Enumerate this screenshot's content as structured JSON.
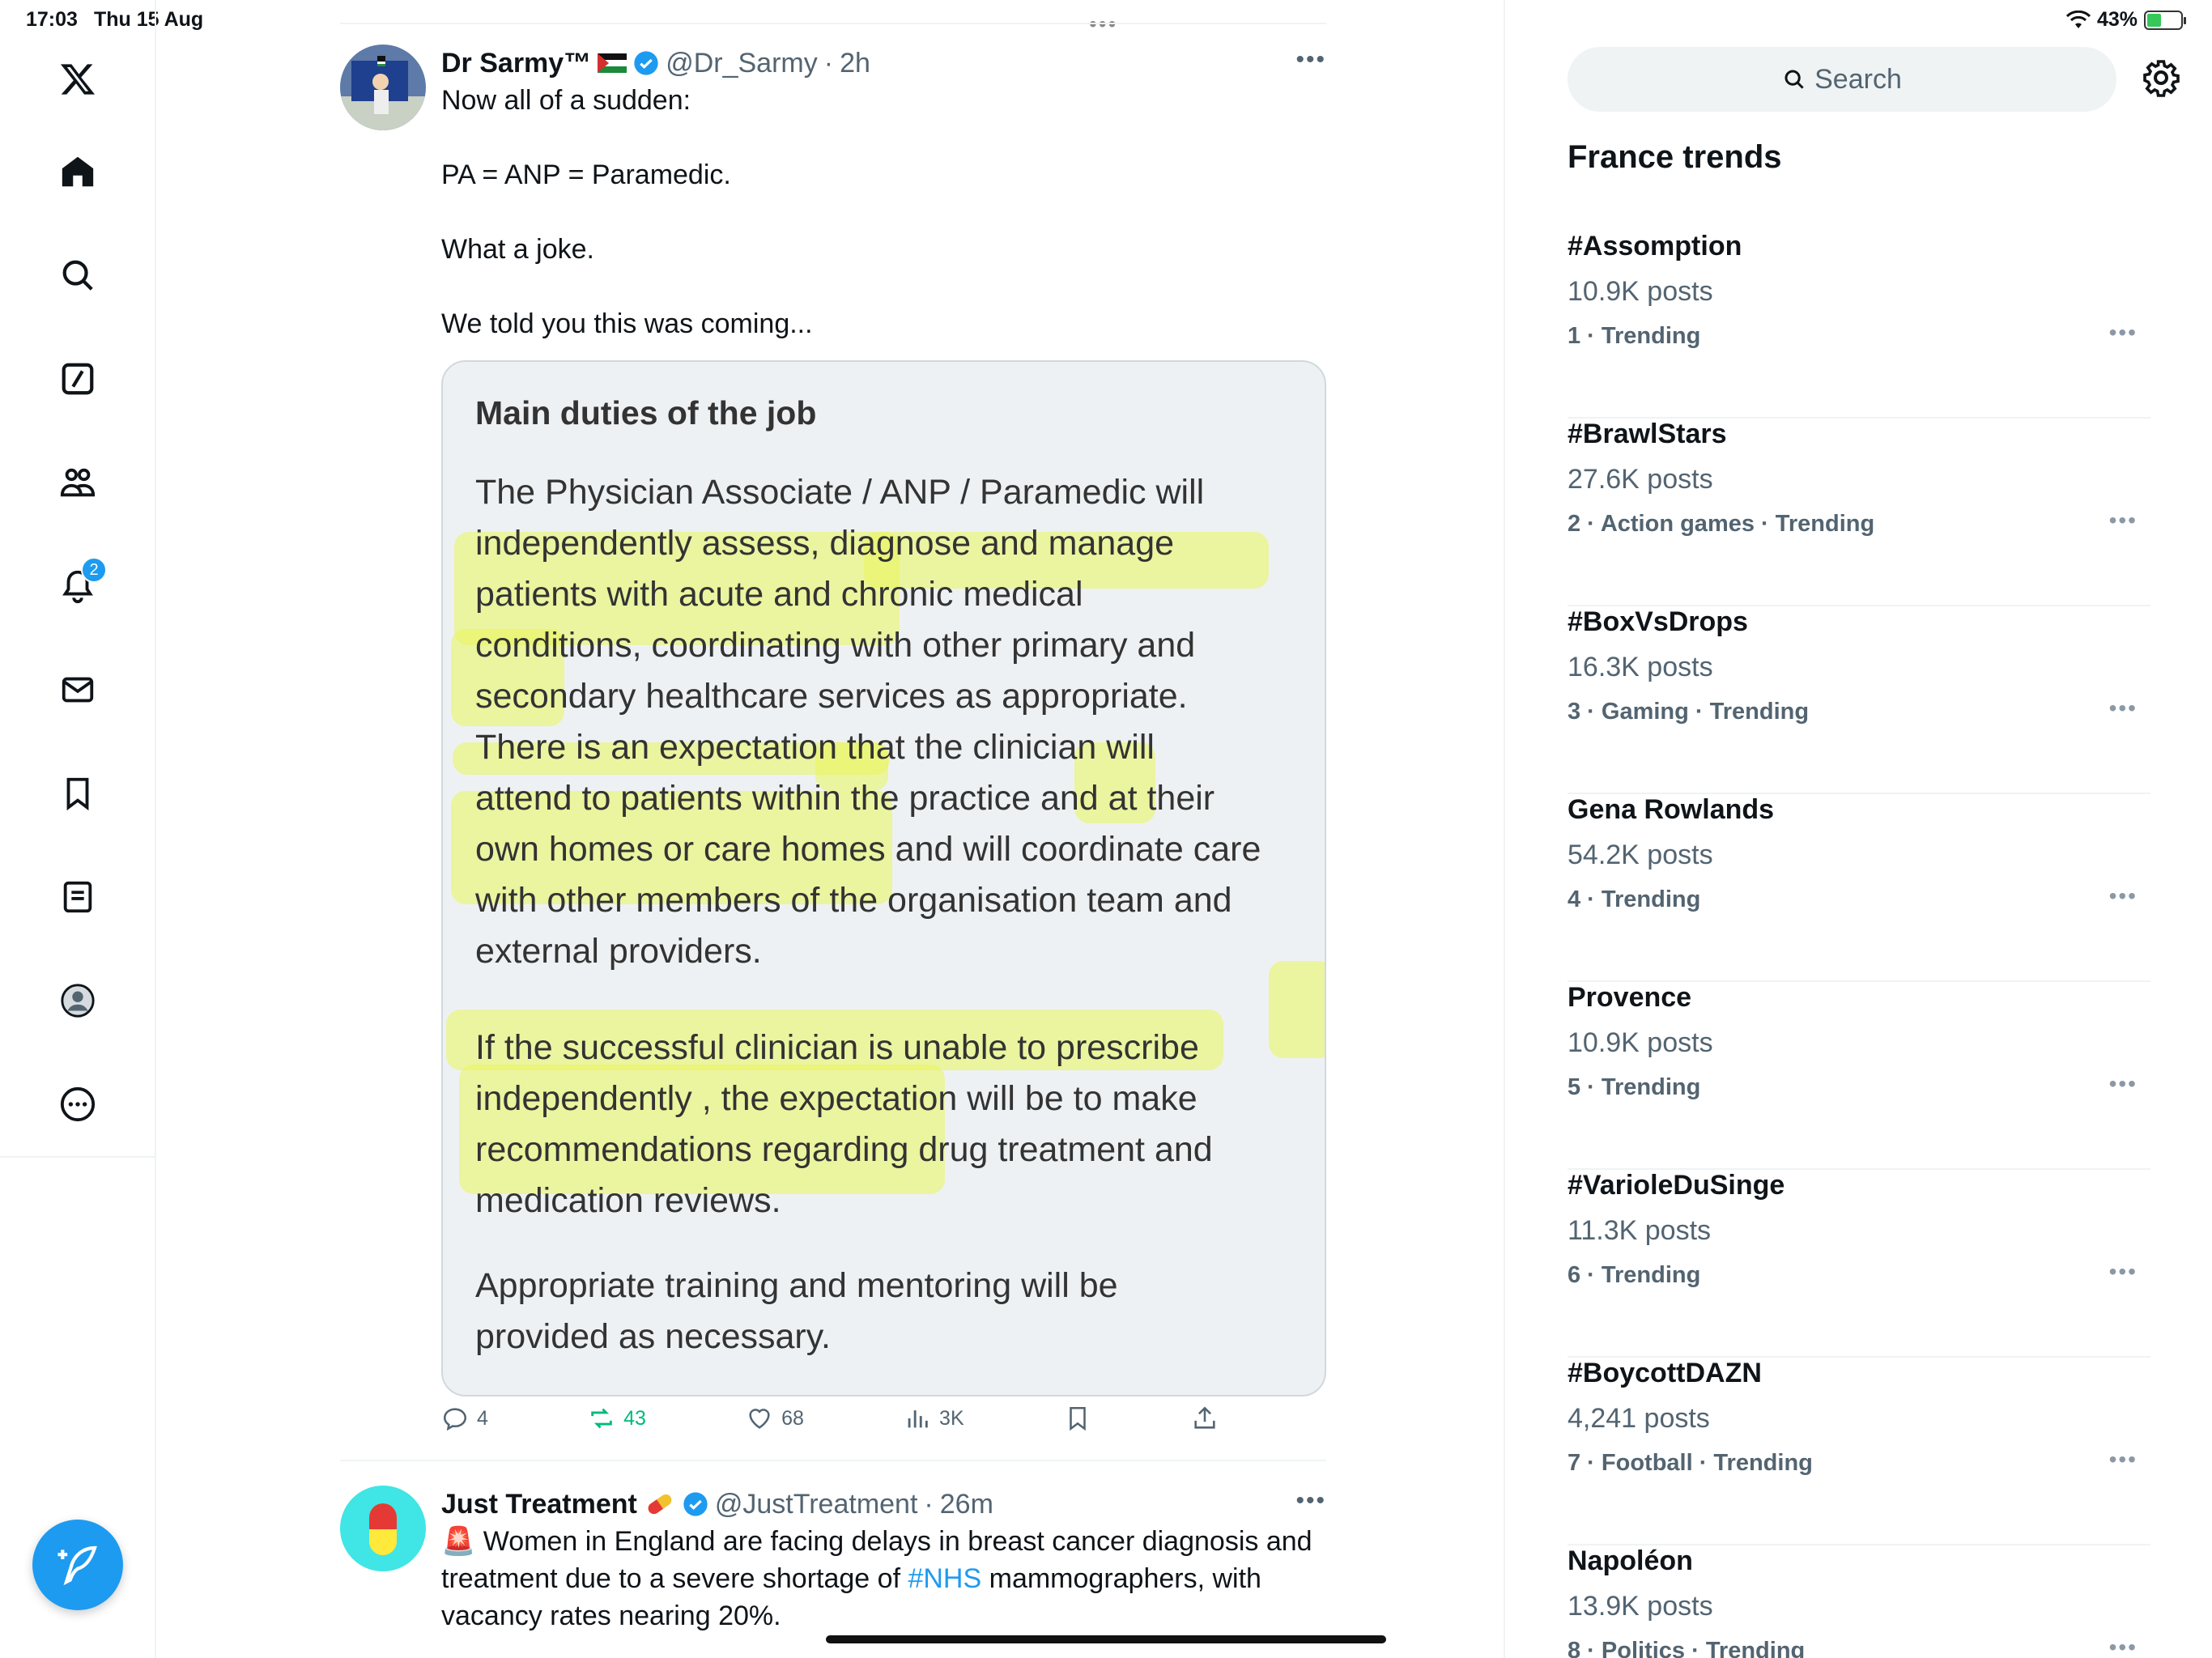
{
  "status_bar": {
    "time": "17:03",
    "date": "Thu 15 Aug",
    "battery": "43%",
    "battery_level": 0.43
  },
  "nav": {
    "notifications_badge": "2"
  },
  "tweets": [
    {
      "name": "Dr Sarmy™",
      "handle": "@Dr_Sarmy",
      "separator": "·",
      "time": "2h",
      "text": "Now all of a sudden:\n\nPA = ANP = Paramedic.\n\nWhat a joke.\n\nWe told you this was coming...",
      "card": {
        "title": "Main duties of the job",
        "paragraph1": "The Physician Associate / ANP / Paramedic will\nindependently assess, diagnose and manage\npatients with acute and chronic medical\nconditions, coordinating with other primary and\nsecondary healthcare services as appropriate.\nThere is an expectation that the clinician will\nattend to patients within the practice and at their\nown homes or care homes and will coordinate care\nwith other members of the organisation team and\nexternal providers.",
        "paragraph2": "If the successful clinician is unable to prescribe\nindependently , the expectation will be to make\nrecommendations regarding drug treatment and\nmedication reviews.",
        "paragraph3": "Appropriate training and mentoring will be\nprovided as necessary."
      },
      "actions": {
        "replies": "4",
        "reposts": "43",
        "likes": "68",
        "views": "3K"
      }
    },
    {
      "name": "Just Treatment",
      "handle": "@JustTreatment",
      "separator": "·",
      "time": "26m",
      "text_before": "🚨 Women in England are facing delays in breast cancer diagnosis and treatment due to a severe shortage of ",
      "hashtag": "#NHS",
      "text_after": " mammographers, with vacancy rates nearing 20%."
    }
  ],
  "sidebar": {
    "search_placeholder": "Search",
    "trends_title": "France trends",
    "trends": [
      {
        "title": "#Assomption",
        "posts": "10.9K posts",
        "meta": "1 · Trending"
      },
      {
        "title": "#BrawlStars",
        "posts": "27.6K posts",
        "meta": "2 · Action games · Trending"
      },
      {
        "title": "#BoxVsDrops",
        "posts": "16.3K posts",
        "meta": "3 · Gaming · Trending"
      },
      {
        "title": "Gena Rowlands",
        "posts": "54.2K posts",
        "meta": "4 · Trending"
      },
      {
        "title": "Provence",
        "posts": "10.9K posts",
        "meta": "5 · Trending"
      },
      {
        "title": "#VarioleDuSinge",
        "posts": "11.3K posts",
        "meta": "6 · Trending"
      },
      {
        "title": "#BoycottDAZN",
        "posts": "4,241 posts",
        "meta": "7 · Football · Trending"
      },
      {
        "title": "Napoléon",
        "posts": "13.9K posts",
        "meta": "8 · Politics · Trending"
      }
    ]
  },
  "colors": {
    "accent": "#1d9bf0",
    "repost": "#00ba7c",
    "highlight": "#e9f55a"
  }
}
